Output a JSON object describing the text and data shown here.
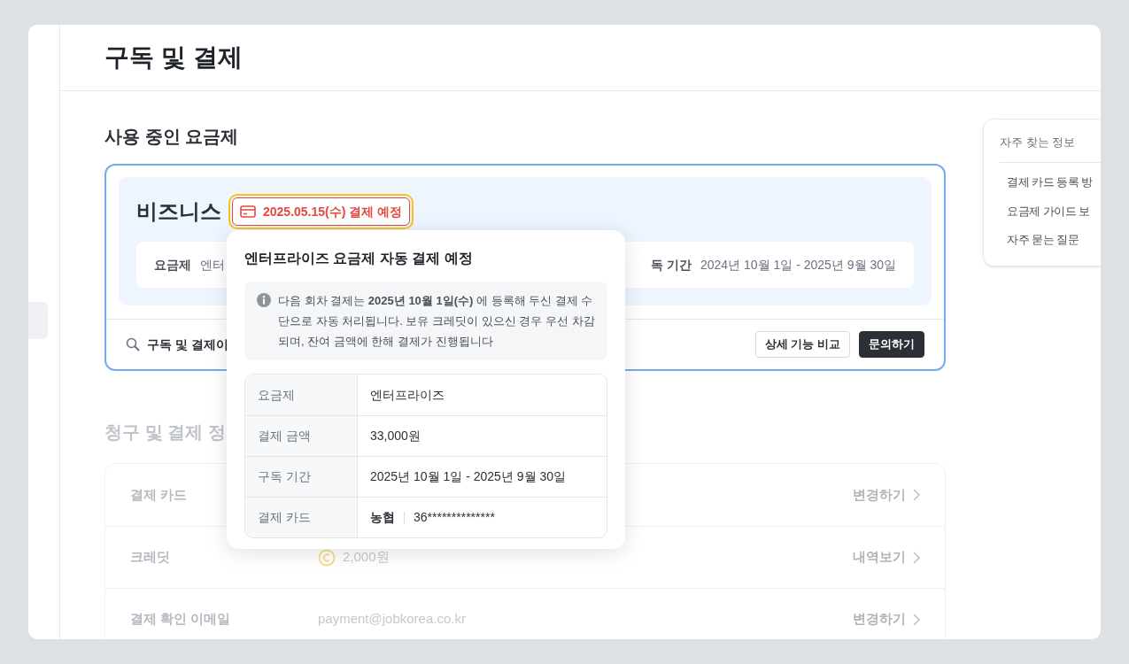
{
  "page": {
    "title": "구독 및 결제"
  },
  "current_plan": {
    "heading": "사용 중인 요금제",
    "plan_name": "비즈니스",
    "badge": "2025.05.15(수) 결제 예정",
    "details": [
      {
        "label": "요금제",
        "value": "엔터"
      },
      {
        "label": "독 기간",
        "value": "2024년 10월 1일 - 2025년 9월 30일"
      }
    ],
    "search_text": "구독 및 결제이",
    "buttons": [
      {
        "label": "상세 기능 비교",
        "kind": "outline"
      },
      {
        "label": "문의하기",
        "kind": "solid"
      }
    ]
  },
  "popover": {
    "title": "엔터프라이즈 요금제 자동 결제 예정",
    "notice": "다음 회차 결제는 **2025년 10월 1일(수)** 에 등록해 두신 결제 수단으로 자동 처리됩니다. 보유 크레딧이 있으신 경우 우선 차감되며, 잔여 금액에 한해 결제가 진행됩니다",
    "rows": [
      {
        "label": "요금제",
        "value": "엔터프라이즈"
      },
      {
        "label": "결제 금액",
        "value": "33,000원"
      },
      {
        "label": "구독 기간",
        "value": "2025년 10월 1일 - 2025년 9월 30일"
      },
      {
        "label": "결제 카드",
        "bank": "농협",
        "value": "36**************"
      }
    ]
  },
  "billing": {
    "heading": "청구 및 결제 정",
    "rows": [
      {
        "label": "결제 카드",
        "kind": "plain",
        "action": "변경하기"
      },
      {
        "label": "크레딧",
        "kind": "credit",
        "value": "2,000원",
        "action": "내역보기"
      },
      {
        "label": "결제 확인 이메일",
        "kind": "plain",
        "value": "payment@jobkorea.co.kr",
        "action": "변경하기"
      }
    ]
  },
  "faq": {
    "title": "자주 찾는 정보",
    "items": [
      "결제 카드 등록 방",
      "요금제 가이드 보",
      "자주 묻는 질문"
    ]
  }
}
